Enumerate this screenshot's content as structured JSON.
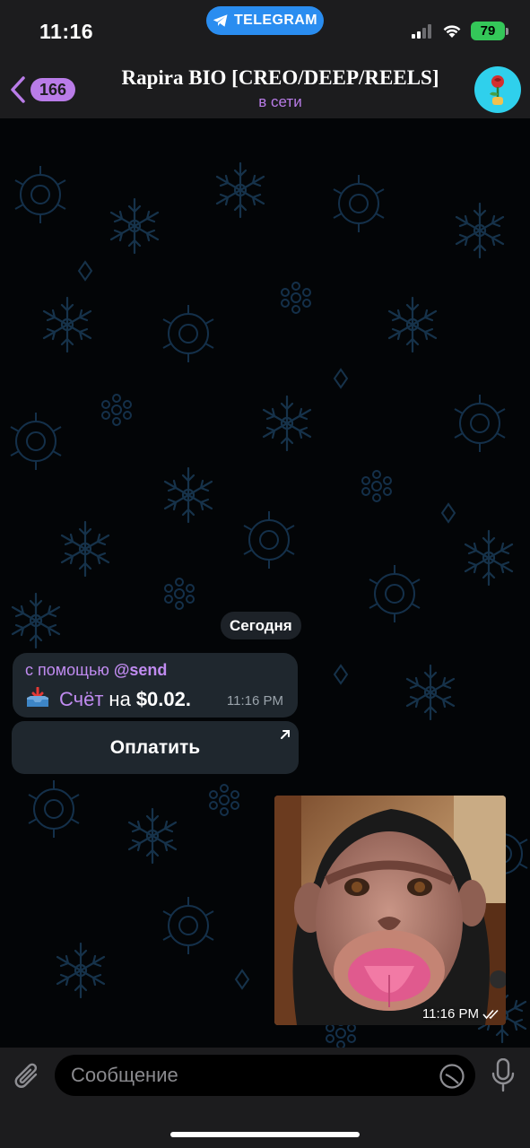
{
  "status_bar": {
    "time": "11:16",
    "app_pill": "TELEGRAM",
    "battery": "79"
  },
  "header": {
    "back_count": "166",
    "title": "Rapira BIO [CREO/DEEP/REELS]",
    "status": "в сети"
  },
  "chat": {
    "date_separator": "Сегодня",
    "invoice_message": {
      "via_prefix": "с помощью",
      "via_bot": "@send",
      "invoice_word": "Счёт",
      "on_word": "на",
      "amount": "$0.02.",
      "time": "11:16 PM"
    },
    "pay_button_label": "Оплатить",
    "photo_message": {
      "time": "11:16 PM"
    }
  },
  "input": {
    "placeholder": "Сообщение"
  },
  "colors": {
    "accent": "#b97ce8",
    "telegram_blue": "#2a8df0",
    "battery_green": "#34c759",
    "bubble": "#1f272e"
  }
}
